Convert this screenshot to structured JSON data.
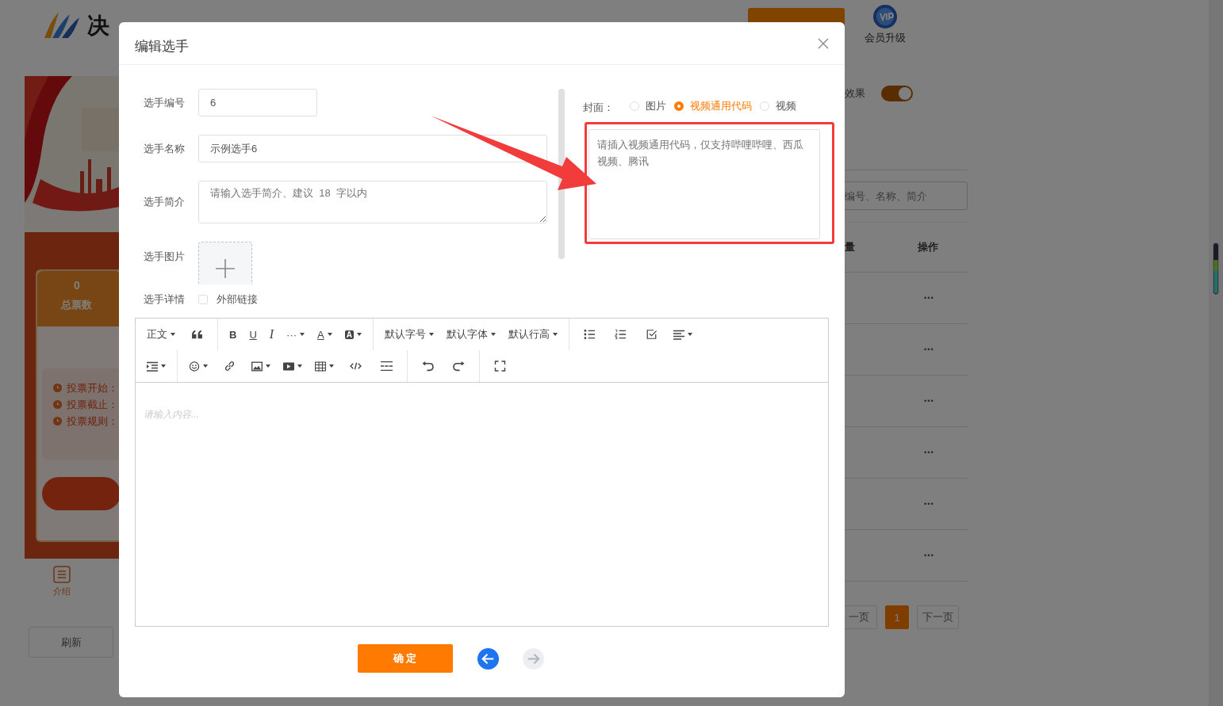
{
  "background": {
    "logo": "决",
    "vip_label": "会员升级",
    "preview": {
      "total_votes": "0",
      "total_votes_label": "总票数",
      "info": [
        "投票开始：",
        "投票截止：",
        "投票规则："
      ],
      "tab_label": "介绍"
    },
    "refresh_button": "刷新",
    "effect_label": "效果",
    "effect_toggle": {
      "on": true
    },
    "search": {
      "placeholder": "编号、名称、简介"
    },
    "table": {
      "columns": [
        "量",
        "操作"
      ],
      "rows": [
        {
          "action": "•••"
        },
        {
          "action": "•••"
        },
        {
          "action": "•••"
        },
        {
          "action": "•••"
        },
        {
          "action": "•••"
        },
        {
          "action": "•••"
        }
      ]
    },
    "pagination": {
      "prev": "一页",
      "pages": [
        {
          "label": "1",
          "selected": true
        }
      ],
      "next": "下一页"
    }
  },
  "dialog": {
    "title": "编辑选手",
    "fields": {
      "number": {
        "label": "选手编号",
        "value": "6"
      },
      "name": {
        "label": "选手名称",
        "value": "示例选手6"
      },
      "intro": {
        "label": "选手简介",
        "placeholder": "请输入选手简介、建议  18  字以内"
      },
      "image": {
        "label": "选手图片"
      },
      "details": {
        "label": "选手详情",
        "checkbox": {
          "label": "外部链接",
          "checked": false
        }
      }
    },
    "cover": {
      "label": "封面：",
      "options": [
        {
          "label": "图片",
          "selected": false
        },
        {
          "label": "视频通用代码",
          "selected": true
        },
        {
          "label": "视频",
          "selected": false
        }
      ],
      "placeholder": "请插入视频通用代码，仅支持哔哩哔哩、西瓜视频、腾讯"
    },
    "editor": {
      "toolbar": {
        "format": "正文",
        "bold": "B",
        "underline": "U",
        "italic": "I",
        "more": "···",
        "font_color": "A",
        "bg_color": "A",
        "font_size": "默认字号",
        "font_family": "默认字体",
        "line_height": "默认行高"
      },
      "placeholder": "请输入内容..."
    },
    "confirm_button": "确 定"
  }
}
